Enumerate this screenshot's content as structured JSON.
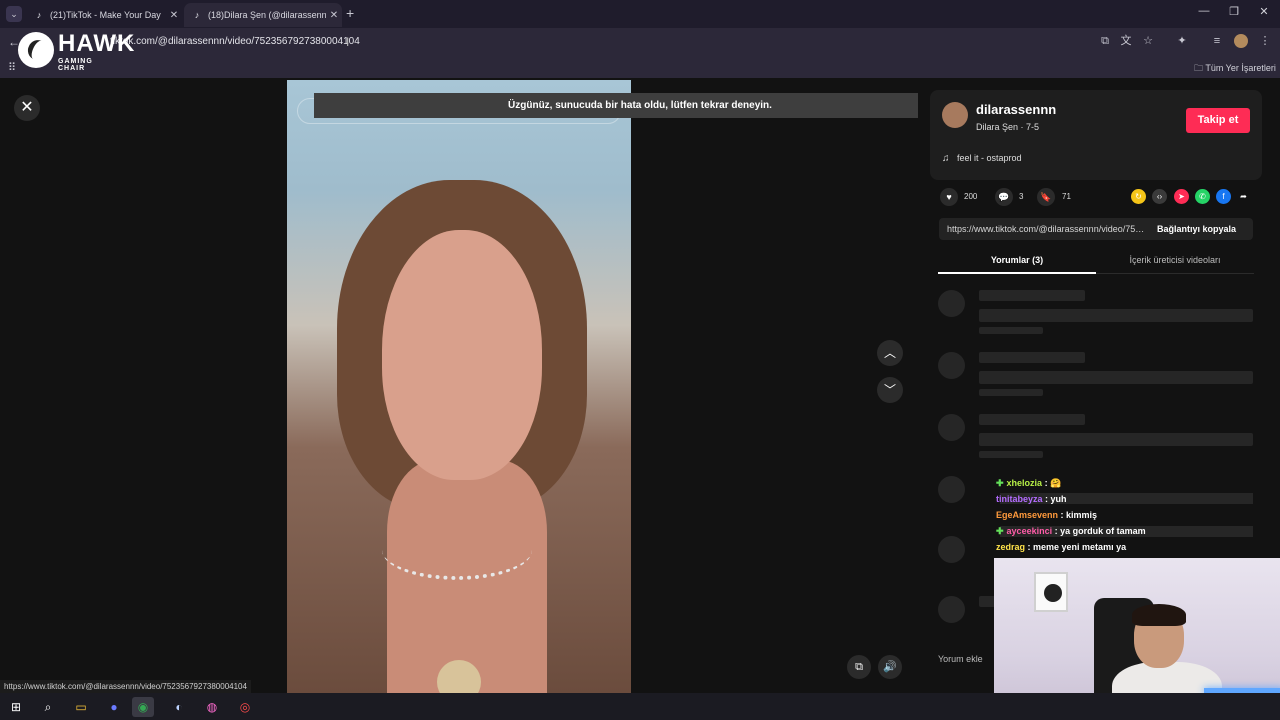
{
  "browser": {
    "tabs": [
      {
        "title": "(21)TikTok - Make Your Day",
        "active": false
      },
      {
        "title": "(18)Dilara Şen (@dilarassennn)",
        "active": true
      }
    ],
    "url": "tiktok.com/@dilarassennn/video/7523567927380004104",
    "bookmarks_all": "Tüm Yer İşaretleri"
  },
  "overlay_logo": {
    "word": "HAWK",
    "sub": "GAMING CHAIR"
  },
  "page": {
    "error_message": "Üzgünüz, sunucuda bir hata oldu, lütfen tekrar deneyin."
  },
  "author": {
    "username": "dilarassennn",
    "display": "Dilara Şen · 7-5",
    "follow_label": "Takip et",
    "music": "feel it - ostaprod"
  },
  "stats": {
    "likes": "200",
    "comments": "3",
    "saves": "71"
  },
  "share": {
    "link": "https://www.tiktok.com/@dilarassennn/video/7523567927380004104",
    "copy_label": "Bağlantıyı kopyala"
  },
  "panel_tabs": {
    "comments": "Yorumlar (3)",
    "creator_videos": "İçerik üreticisi videoları"
  },
  "comment_input": {
    "placeholder": "Yorum ekle"
  },
  "chat": [
    {
      "user": "xhelozia",
      "msg": ": 🤗",
      "color": "#b7f047",
      "badge": true
    },
    {
      "user": "tinitabeyza",
      "msg": ": yuh",
      "color": "#b46cff",
      "badge": false
    },
    {
      "user": "EgeAmsevenn",
      "msg": ": kimmiş",
      "color": "#ff9a3c",
      "badge": false
    },
    {
      "user": "ayceekinci",
      "msg": ": ya gorduk of tamam",
      "color": "#ff5ca8",
      "badge": true
    },
    {
      "user": "zedrag",
      "msg": ": meme yeni metamı ya",
      "color": "#ffe34a",
      "badge": false
    }
  ],
  "status_url": "https://www.tiktok.com/@dilarassennn/video/7523567927380004104",
  "colors": {
    "follow": "#fe2c55",
    "page_bg": "#121212",
    "chrome": "#2c2839"
  }
}
